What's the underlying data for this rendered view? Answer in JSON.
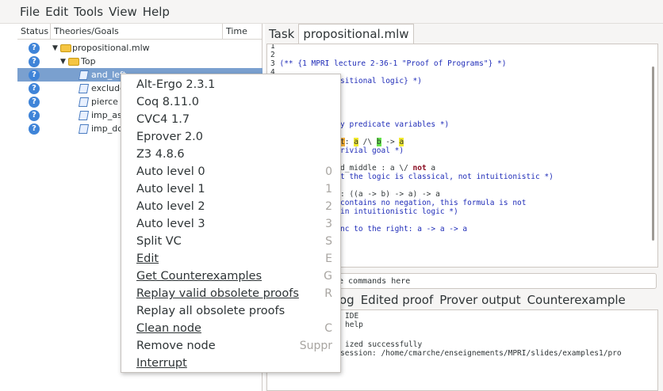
{
  "menubar": [
    "File",
    "Edit",
    "Tools",
    "View",
    "Help"
  ],
  "tree": {
    "headers": {
      "status": "Status",
      "goals": "Theories/Goals",
      "time": "Time"
    },
    "rows": [
      {
        "label": "propositional.mlw",
        "type": "file"
      },
      {
        "label": "Top",
        "type": "theory"
      },
      {
        "label": "and_left",
        "type": "goal"
      },
      {
        "label": "exclude",
        "type": "goal"
      },
      {
        "label": "pierce",
        "type": "goal"
      },
      {
        "label": "imp_ass",
        "type": "goal"
      },
      {
        "label": "imp_doe",
        "type": "goal"
      }
    ],
    "status_glyph": "?"
  },
  "right": {
    "tab_task": "Task",
    "tab_file": "propositional.mlw",
    "lines": [
      {
        "num": "1",
        "text": ""
      },
      {
        "num": "2",
        "text": ""
      },
      {
        "num": "3",
        "text": "(** {1 MPRI lecture 2-36-1 \"Proof of Programs\"} *)"
      },
      {
        "num": "4",
        "text": ""
      },
      {
        "num": "",
        "text": "sitional logic} *)"
      },
      {
        "num": "",
        "text": ""
      },
      {
        "num": "",
        "text": ""
      },
      {
        "num": "",
        "text": ""
      },
      {
        "num": "",
        "text": "y predicate variables *)"
      },
      {
        "num": "",
        "text": ""
      },
      {
        "num": "",
        "text": "t: a /\\ b -> a"
      },
      {
        "num": "",
        "text": "rivial goal *)"
      },
      {
        "num": "",
        "text": ""
      },
      {
        "num": "",
        "text": "d_middle : a \\/ not a"
      },
      {
        "num": "",
        "text": "t the logic is classical, not intuitionistic *)"
      },
      {
        "num": "",
        "text": ""
      },
      {
        "num": "",
        "text": ": ((a -> b) -> a) -> a"
      },
      {
        "num": "",
        "text": "contains no negation, this formula is not"
      },
      {
        "num": "",
        "text": " in intuitionistic logic *)"
      },
      {
        "num": "",
        "text": ""
      },
      {
        "num": "",
        "text": "nc to the right: a -> a -> a"
      }
    ],
    "cmd_placeholder": "e commands here",
    "bottom_tabs": [
      "og",
      "Edited proof",
      "Prover output",
      "Counterexample"
    ],
    "messages": [
      "IDE",
      "help",
      "",
      "ized successfully",
      " session: /home/cmarche/enseignements/MPRI/slides/examples1/pro"
    ]
  },
  "context_menu": [
    {
      "label": "Alt-Ergo 2.3.1",
      "accel": ""
    },
    {
      "label": "Coq 8.11.0",
      "accel": ""
    },
    {
      "label": "CVC4 1.7",
      "accel": ""
    },
    {
      "label": "Eprover 2.0",
      "accel": ""
    },
    {
      "label": "Z3 4.8.6",
      "accel": ""
    },
    {
      "label": "Auto level 0",
      "accel": "0"
    },
    {
      "label": "Auto level 1",
      "accel": "1"
    },
    {
      "label": "Auto level 2",
      "accel": "2"
    },
    {
      "label": "Auto level 3",
      "accel": "3"
    },
    {
      "label": "Split VC",
      "accel": "S"
    },
    {
      "label": "Edit",
      "accel": "E"
    },
    {
      "label": "Get Counterexamples",
      "accel": "G"
    },
    {
      "label": "Replay valid obsolete proofs",
      "accel": "R"
    },
    {
      "label": "Replay all obsolete proofs",
      "accel": ""
    },
    {
      "label": "Clean node",
      "accel": "C"
    },
    {
      "label": "Remove node",
      "accel": "Suppr"
    },
    {
      "label": "Interrupt",
      "accel": ""
    }
  ]
}
